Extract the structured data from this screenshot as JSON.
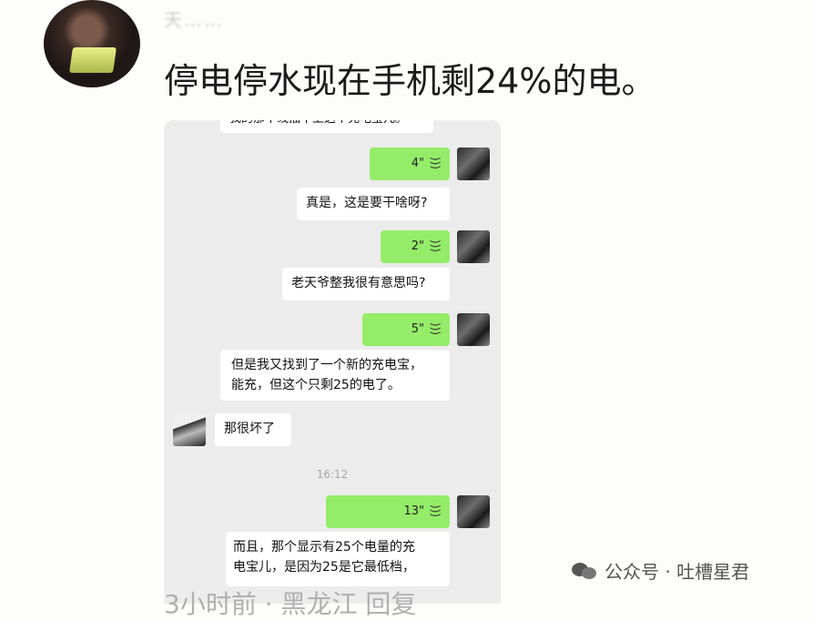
{
  "post": {
    "username": "天……",
    "text": "停电停水现在手机剩24%的电。"
  },
  "chat": {
    "top_partial": "我的那个线插不上这个充电宝儿。",
    "messages": [
      {
        "type": "voice",
        "side": "self",
        "duration": "4\""
      },
      {
        "type": "text",
        "side": "other",
        "text": "真是，这是要干啥呀?"
      },
      {
        "type": "voice",
        "side": "self",
        "duration": "2\""
      },
      {
        "type": "text",
        "side": "other",
        "text": "老天爷整我很有意思吗?"
      },
      {
        "type": "voice",
        "side": "self",
        "duration": "5\""
      },
      {
        "type": "text",
        "side": "other",
        "lines": [
          "但是我又找到了一个新的充电宝，",
          "能充，但这个只剩25的电了。"
        ]
      },
      {
        "type": "text",
        "side": "left",
        "text": "那很坏了"
      },
      {
        "type": "time",
        "text": "16:12"
      },
      {
        "type": "voice",
        "side": "self",
        "duration": "13\""
      },
      {
        "type": "text",
        "side": "other",
        "lines": [
          "而且，那个显示有25个电量的充",
          "电宝儿，是因为25是它最低档，"
        ]
      }
    ]
  },
  "footer": {
    "text": "3小时前 · 黑龙江   回复"
  },
  "watermark": {
    "text": "公众号 · 吐槽星君"
  }
}
